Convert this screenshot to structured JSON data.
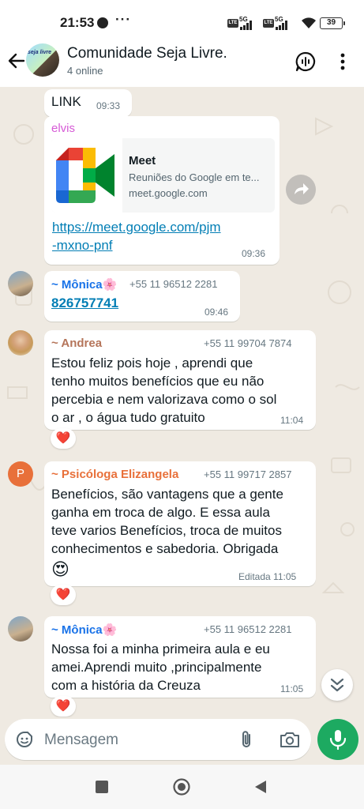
{
  "status_bar": {
    "time": "21:53",
    "dots": "···",
    "battery": "39",
    "net1": "5G",
    "net2": "5G",
    "lte": "LTE"
  },
  "header": {
    "title": "Comunidade Seja Livre.",
    "subtitle": "4 online",
    "avatar_text": "seja livre"
  },
  "messages": {
    "m1": {
      "text": "LINK",
      "time": "09:33"
    },
    "m2": {
      "sender": "elvis",
      "card_title": "Meet",
      "card_desc": "Reuniões do Google em te...",
      "card_domain": "meet.google.com",
      "url_line1": "https://meet.google.com/pjm",
      "url_line2": "-mxno-pnf",
      "time": "09:36"
    },
    "m3": {
      "sender": "~ Mônica🌸",
      "phone": "+55 11 96512 2281",
      "link": "826757741",
      "time": "09:46"
    },
    "m4": {
      "sender": "~ Andrea",
      "phone": "+55 11 99704 7874",
      "lines": [
        "Estou feliz pois hoje , aprendi que",
        "tenho muitos benefícios que eu não",
        "percebia e nem valorizava como o sol",
        "o ar , o água tudo gratuito"
      ],
      "time": "11:04",
      "reaction": "❤️"
    },
    "m5": {
      "avatar_letter": "P",
      "sender": "~ Psicóloga Elizangela",
      "phone": "+55 11 99717 2857",
      "lines": [
        "Benefícios, são vantagens que a gente",
        "ganha em troca de algo. E essa aula",
        "teve varios Benefícios, troca de muitos",
        "conhecimentos e sabedoria. Obrigada"
      ],
      "emoji": "😍",
      "time": "Editada 11:05",
      "reaction": "❤️"
    },
    "m6": {
      "sender": "~ Mônica🌸",
      "phone": "+55 11 96512 2281",
      "lines": [
        "Nossa foi a minha primeira  aula e eu",
        "amei.Aprendi muito ,principalmente",
        "com a história  da Creuza"
      ],
      "time": "11:05",
      "reaction": "❤️"
    }
  },
  "input": {
    "placeholder": "Mensagem"
  },
  "colors": {
    "accent_green": "#1daa61",
    "link_blue": "#027eb5",
    "sender_monica": "#1a73e8",
    "sender_andrea": "#b5755a",
    "sender_elizangela": "#e8703a",
    "chat_bg": "#efeae2"
  }
}
